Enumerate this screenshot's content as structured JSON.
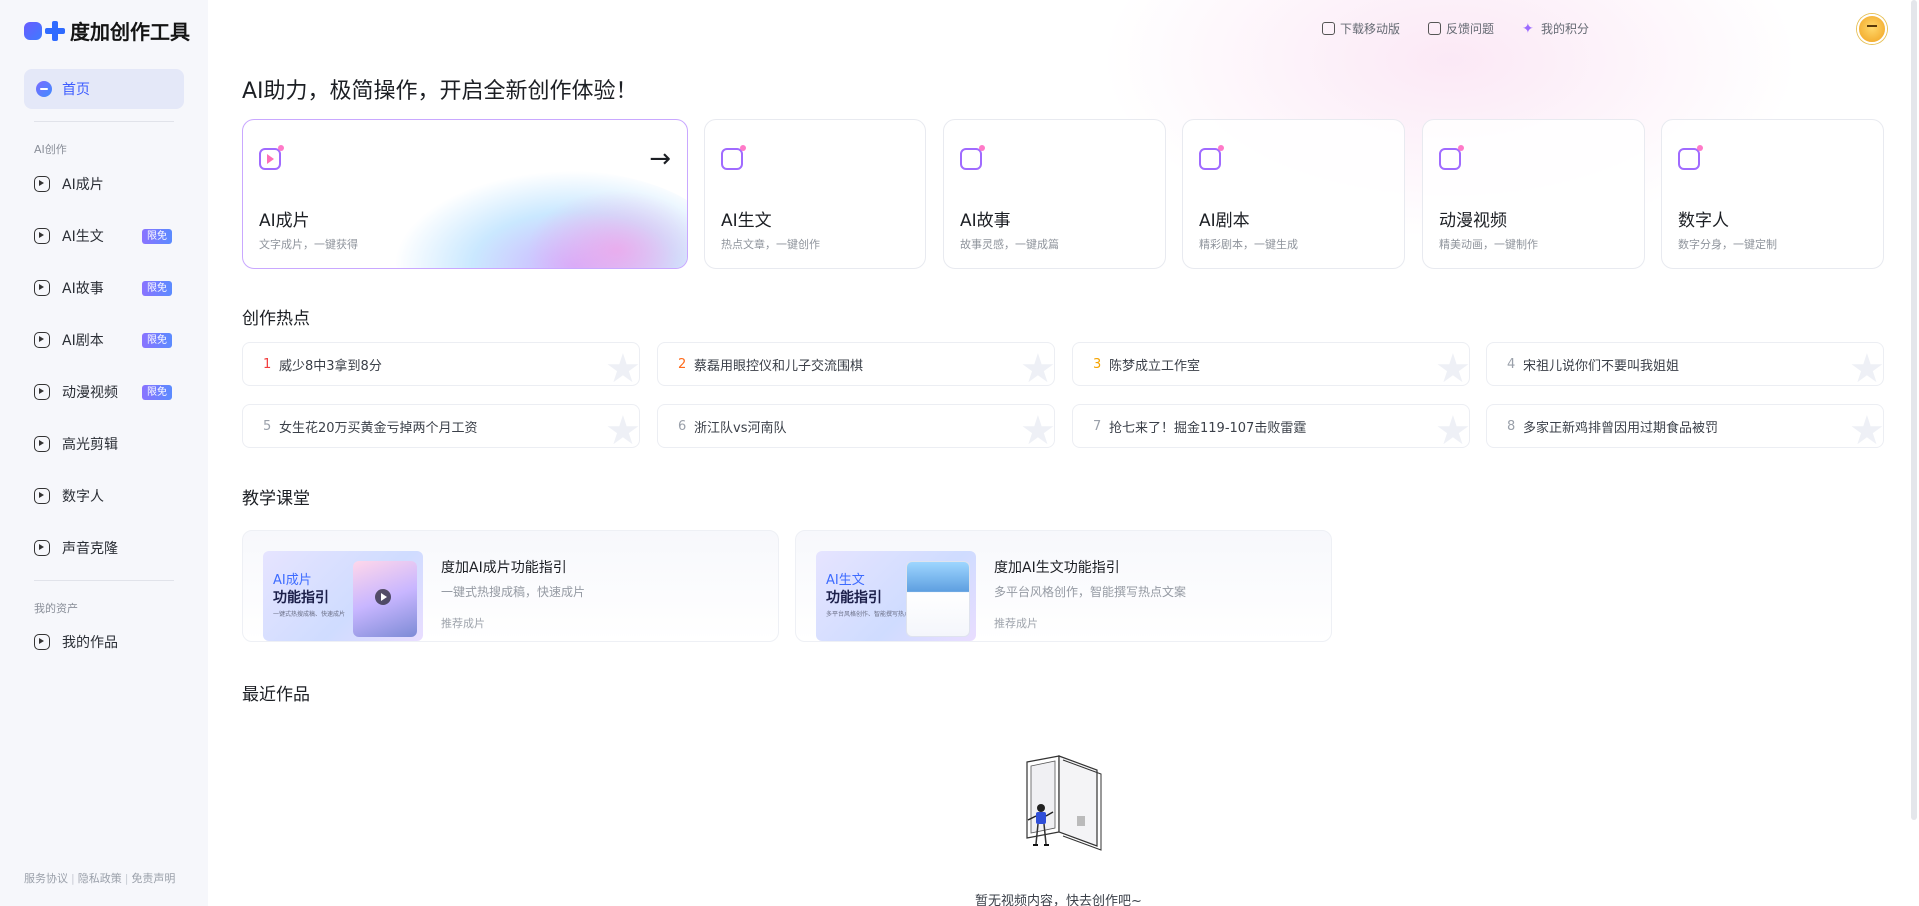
{
  "app": {
    "logo_text": "度加创作工具"
  },
  "sidebar": {
    "home_label": "首页",
    "section_create": "AI创作",
    "items": [
      {
        "label": "AI成片",
        "badge": ""
      },
      {
        "label": "AI生文",
        "badge": "限免"
      },
      {
        "label": "AI故事",
        "badge": "限免"
      },
      {
        "label": "AI剧本",
        "badge": "限免"
      },
      {
        "label": "动漫视频",
        "badge": "限免"
      },
      {
        "label": "高光剪辑",
        "badge": ""
      },
      {
        "label": "数字人",
        "badge": ""
      },
      {
        "label": "声音克隆",
        "badge": ""
      }
    ],
    "section_assets": "我的资产",
    "my_works": "我的作品",
    "footer": {
      "terms": "服务协议",
      "privacy": "隐私政策",
      "disclaimer": "免责声明"
    }
  },
  "header": {
    "download_mobile": "下载移动版",
    "feedback": "反馈问题",
    "points": "我的积分"
  },
  "main": {
    "title": "AI助力，极简操作，开启全新创作体验！",
    "cards": [
      {
        "title": "AI成片",
        "desc": "文字成片，一键获得"
      },
      {
        "title": "AI生文",
        "desc": "热点文章，一键创作"
      },
      {
        "title": "AI故事",
        "desc": "故事灵感，一键成篇"
      },
      {
        "title": "AI剧本",
        "desc": "精彩剧本，一键生成"
      },
      {
        "title": "动漫视频",
        "desc": "精美动画，一键制作"
      },
      {
        "title": "数字人",
        "desc": "数字分身，一键定制"
      }
    ],
    "hot_title": "创作热点",
    "hot_topics": [
      {
        "rank": "1",
        "text": "威少8中3拿到8分"
      },
      {
        "rank": "2",
        "text": "蔡磊用眼控仪和儿子交流围棋"
      },
      {
        "rank": "3",
        "text": "陈梦成立工作室"
      },
      {
        "rank": "4",
        "text": "宋祖儿说你们不要叫我姐姐"
      },
      {
        "rank": "5",
        "text": "女生花20万买黄金亏掉两个月工资"
      },
      {
        "rank": "6",
        "text": "浙江队vs河南队"
      },
      {
        "rank": "7",
        "text": "抢七来了！掘金119-107击败雷霆"
      },
      {
        "rank": "8",
        "text": "多家正新鸡排曾因用过期食品被罚"
      }
    ],
    "tutorial_title": "教学课堂",
    "tutorials": [
      {
        "thumb_line1": "AI成片",
        "thumb_line2": "功能指引",
        "thumb_line3": "一键式热搜成稿、快速成片",
        "title": "度加AI成片功能指引",
        "desc": "一键式热搜成稿，快速成片",
        "tag": "推荐成片"
      },
      {
        "thumb_line1": "AI生文",
        "thumb_line2": "功能指引",
        "thumb_line3": "多平台风格创作、智能撰写热点文案",
        "title": "度加AI生文功能指引",
        "desc": "多平台风格创作，智能撰写热点文案",
        "tag": "推荐成片"
      }
    ],
    "recent_title": "最近作品",
    "empty_text": "暂无视频内容，快去创作吧~"
  }
}
